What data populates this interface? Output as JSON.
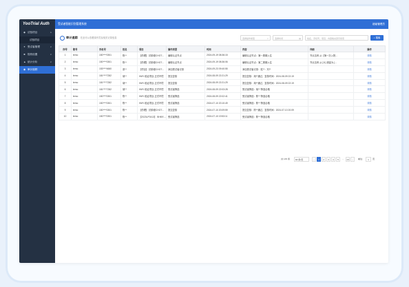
{
  "sidebar": {
    "logo": "YooTrial Auth",
    "items": [
      {
        "label": "试验项目",
        "icon": "flask-icon",
        "sub": [
          "试验项目"
        ]
      },
      {
        "label": "受试者管理",
        "icon": "user-icon"
      },
      {
        "label": "规则设置",
        "icon": "book-icon"
      },
      {
        "label": "统计分析",
        "icon": "chart-icon"
      },
      {
        "label": "审计追踪",
        "icon": "audit-icon",
        "active": true
      }
    ]
  },
  "topbar": {
    "title": "受试者智能识别管理系统",
    "user": "超级管理员"
  },
  "main": {
    "title": "审计追踪",
    "subtitle": "在此可以查看操作员及相关记录信息",
    "filters": {
      "field1": "选择操作类型",
      "field2": "选择时间",
      "field3": "姓名、手机号、项目、内容等关键字搜索",
      "search_label": "搜索"
    },
    "columns": [
      "序号",
      "账号",
      "手机号",
      "姓名",
      "项目",
      "操作类型",
      "时间",
      "内容",
      "详细",
      "操作"
    ],
    "rows": [
      [
        "1",
        "temo",
        "150****0301",
        "陈**",
        "【药理】 抗肿瘤CHOT...",
        "编辑认证节点",
        "2024-09-19 08:36:15",
        "编辑认证节点：第一周期入住",
        "节点名称 从【第一次入院...",
        "详情"
      ],
      [
        "2",
        "temo",
        "150****0301",
        "陈**",
        "【药理】 抗肿瘤CHOT...",
        "编辑认证节点",
        "2024-09-19 08:36:06",
        "编辑认证节点：第二周期入住",
        "节点名称 从 [11] 调高为 [...",
        "详情"
      ],
      [
        "3",
        "temo",
        "153****4660",
        "张**",
        "【项目】 抗肿瘤CHOT...",
        "添加受试者记录",
        "2024-09-23 09:40:55",
        "添加受试者记录：姓**：刘**",
        "",
        "详情"
      ],
      [
        "4",
        "temo",
        "181****7282",
        "胡**",
        "HMY-验证项目-正式环境",
        "提交复核",
        "2024-08-09 22:21:29",
        "提交复核：胡**通过，复核时间：2024-08-09 22:19",
        "",
        "详情"
      ],
      [
        "5",
        "temo",
        "181****7282",
        "胡**",
        "HMY-验证项目-正式环境",
        "提交复核",
        "2024-08-09 22:21:29",
        "提交复核：胡**通过，复核时间：2024-08-09 22:19",
        "",
        "详情"
      ],
      [
        "6",
        "temo",
        "181****7282",
        "胡**",
        "HMY-验证项目-正式环境",
        "受试者筛选",
        "2024-08-09 22:03:28",
        "受试者筛选：胡** 筛选合格",
        "",
        "详情"
      ],
      [
        "7",
        "temo",
        "150****0301",
        "陈**",
        "HMY-验证项目-正式环境",
        "受试者筛选",
        "2024-08-09 22:02:41",
        "受试者筛选：陈** 筛选合格",
        "",
        "详情"
      ],
      [
        "8",
        "temo",
        "150****0301",
        "陈**",
        "HMY-验证项目-正式环境",
        "受试者筛选",
        "2024-07-10 20:10:49",
        "受试者筛选：陈** 筛选合格",
        "",
        "详情"
      ],
      [
        "9",
        "temo",
        "150****0301",
        "陈**",
        "【药理】 抗肿瘤CHOT...",
        "提交复核",
        "2024-07-10 20:09:59",
        "提交复核：陈**通过，复核时间：2024-07-10 20:09",
        "",
        "详情"
      ],
      [
        "10",
        "temo",
        "150****0301",
        "陈**",
        "【2023LP0413】 BHMY-...",
        "受试者筛选",
        "2024-07-10 19:53:11",
        "受试者筛选：陈** 筛选合格",
        "",
        "详情"
      ]
    ],
    "pager": {
      "total": "共 135 条",
      "size": "10 条/页",
      "pages": [
        "1",
        "2",
        "3",
        "4",
        "5",
        "...",
        "13"
      ],
      "current": "1",
      "goto_label": "前往",
      "goto_value": "1",
      "page_suffix": "页"
    }
  }
}
